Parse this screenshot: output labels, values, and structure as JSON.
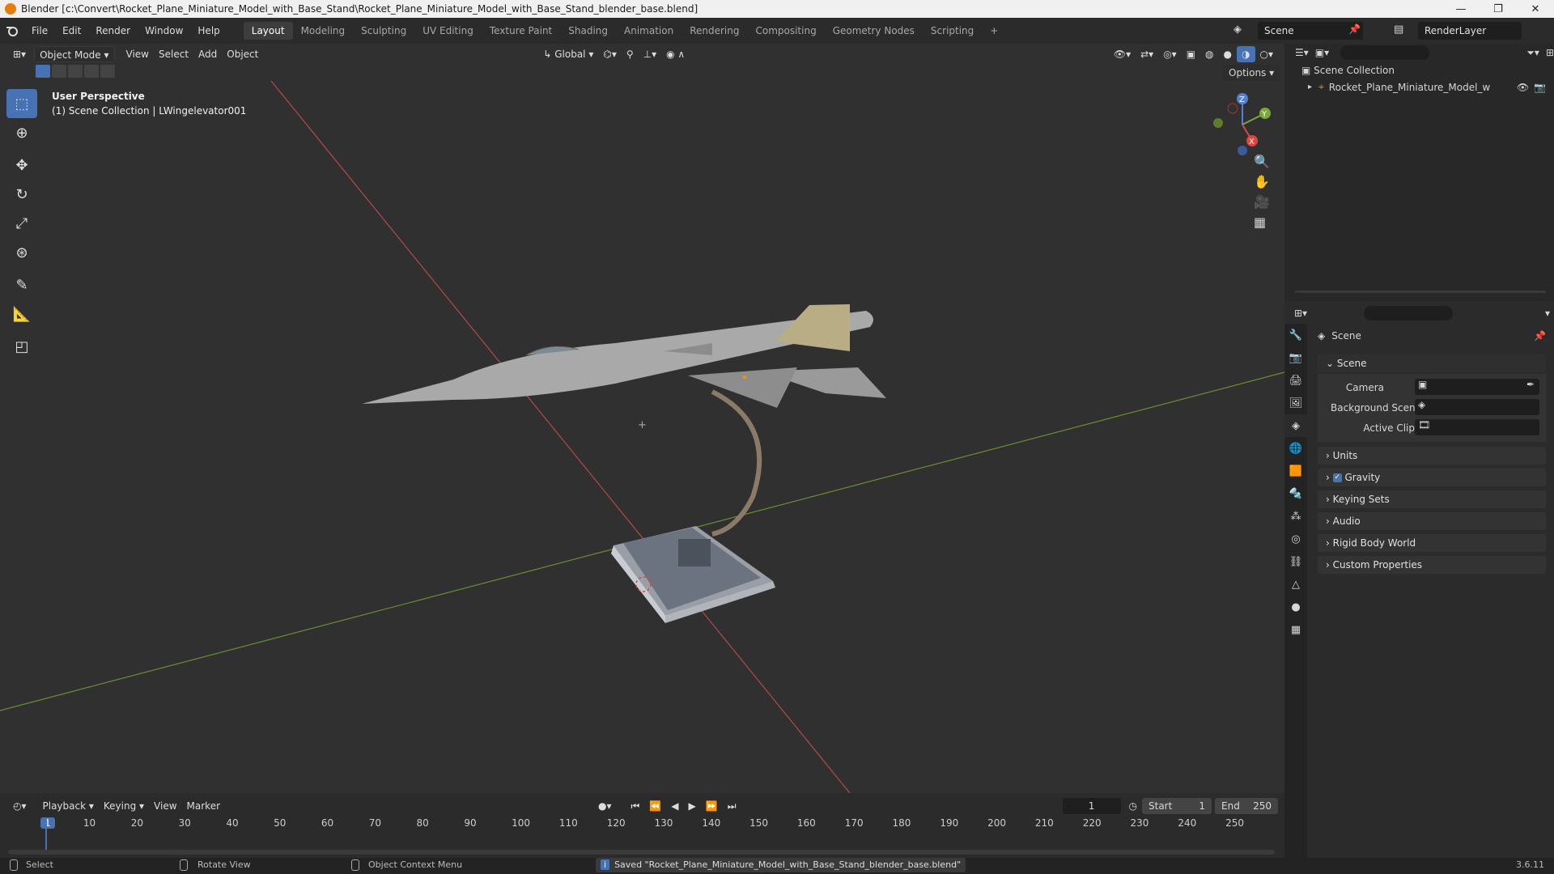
{
  "window": {
    "title": "Blender [c:\\Convert\\Rocket_Plane_Miniature_Model_with_Base_Stand\\Rocket_Plane_Miniature_Model_with_Base_Stand_blender_base.blend]"
  },
  "menu": [
    "File",
    "Edit",
    "Render",
    "Window",
    "Help"
  ],
  "workspaces": [
    "Layout",
    "Modeling",
    "Sculpting",
    "UV Editing",
    "Texture Paint",
    "Shading",
    "Animation",
    "Rendering",
    "Compositing",
    "Geometry Nodes",
    "Scripting"
  ],
  "scene_name": "Scene",
  "render_layer": "RenderLayer",
  "viewport": {
    "mode": "Object Mode",
    "menu": [
      "View",
      "Select",
      "Add",
      "Object"
    ],
    "transform": "Global",
    "options_label": "Options",
    "info_line1": "User Perspective",
    "info_line2": "(1) Scene Collection | LWingelevator001"
  },
  "outliner": {
    "root": "Scene Collection",
    "item": "Rocket_Plane_Miniature_Model_with_Ba"
  },
  "properties": {
    "header": "Scene",
    "section": "Scene",
    "fields": [
      "Camera",
      "Background Scene",
      "Active Clip"
    ],
    "panels": [
      "Units",
      "Gravity",
      "Keying Sets",
      "Audio",
      "Rigid Body World",
      "Custom Properties"
    ]
  },
  "timeline": {
    "menus": [
      "Playback",
      "Keying",
      "View",
      "Marker"
    ],
    "current_frame": "1",
    "start_label": "Start",
    "start": "1",
    "end_label": "End",
    "end": "250",
    "ticks": [
      "1",
      "10",
      "20",
      "30",
      "40",
      "50",
      "60",
      "70",
      "80",
      "90",
      "100",
      "110",
      "120",
      "130",
      "140",
      "150",
      "160",
      "170",
      "180",
      "190",
      "200",
      "210",
      "220",
      "230",
      "240",
      "250"
    ]
  },
  "status": {
    "select": "Select",
    "rotate": "Rotate View",
    "context": "Object Context Menu",
    "message": "Saved \"Rocket_Plane_Miniature_Model_with_Base_Stand_blender_base.blend\"",
    "version": "3.6.11"
  }
}
